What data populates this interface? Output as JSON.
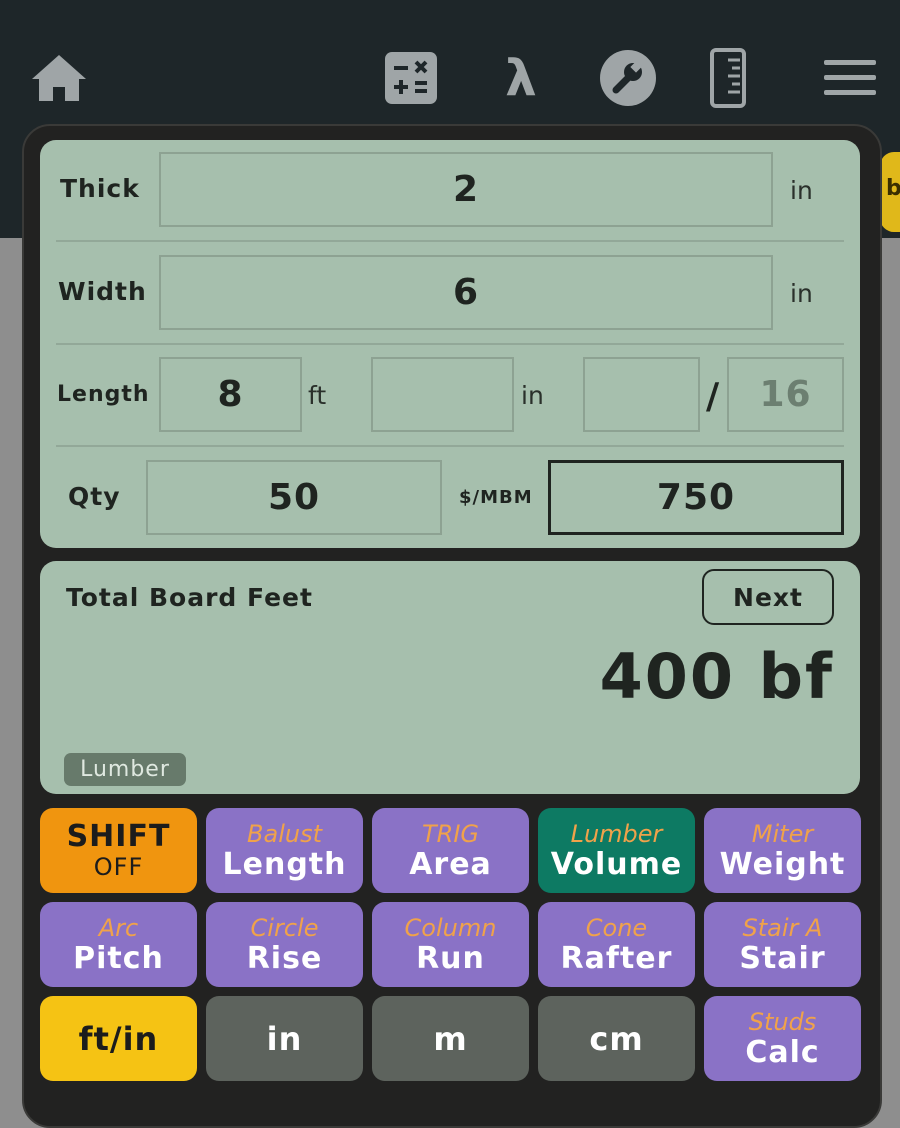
{
  "inputs": {
    "thick": {
      "label": "Thick",
      "value": "2",
      "unit": "in"
    },
    "width": {
      "label": "Width",
      "value": "6",
      "unit": "in"
    },
    "length": {
      "label": "Length",
      "feet": "8",
      "feet_unit": "ft",
      "inches": "",
      "inches_unit": "in",
      "numerator": "",
      "separator": "/",
      "denominator": "16"
    },
    "qty": {
      "label": "Qty",
      "value": "50"
    },
    "price": {
      "label": "$/MBM",
      "value": "750"
    }
  },
  "result": {
    "title": "Total Board Feet",
    "next_label": "Next",
    "value": "400 bf",
    "mode": "Lumber"
  },
  "keys": [
    {
      "kind": "shift",
      "line1": "SHIFT",
      "line2": "OFF"
    },
    {
      "sub": "Balust",
      "main": "Length"
    },
    {
      "sub": "TRIG",
      "main": "Area"
    },
    {
      "sub": "Lumber",
      "main": "Volume"
    },
    {
      "sub": "Miter",
      "main": "Weight"
    },
    {
      "sub": "Arc",
      "main": "Pitch"
    },
    {
      "sub": "Circle",
      "main": "Rise"
    },
    {
      "sub": "Column",
      "main": "Run"
    },
    {
      "sub": "Cone",
      "main": "Rafter"
    },
    {
      "sub": "Stair A",
      "main": "Stair"
    },
    {
      "main": "ft/in"
    },
    {
      "main": "in"
    },
    {
      "main": "m"
    },
    {
      "main": "cm"
    },
    {
      "sub": "Studs",
      "main": "Calc"
    }
  ],
  "colors": {
    "panel": "#a6bfad",
    "purple_key": "#8a72c6",
    "shift_key": "#f0950f",
    "active_key": "#0d7a63",
    "unit_key": "#f5c314",
    "gray_key": "#5d635d",
    "topbar": "#1e2629"
  },
  "icons": [
    "home-icon",
    "calculator-icon",
    "lambda-icon",
    "wrench-icon",
    "ruler-icon",
    "menu-icon"
  ]
}
